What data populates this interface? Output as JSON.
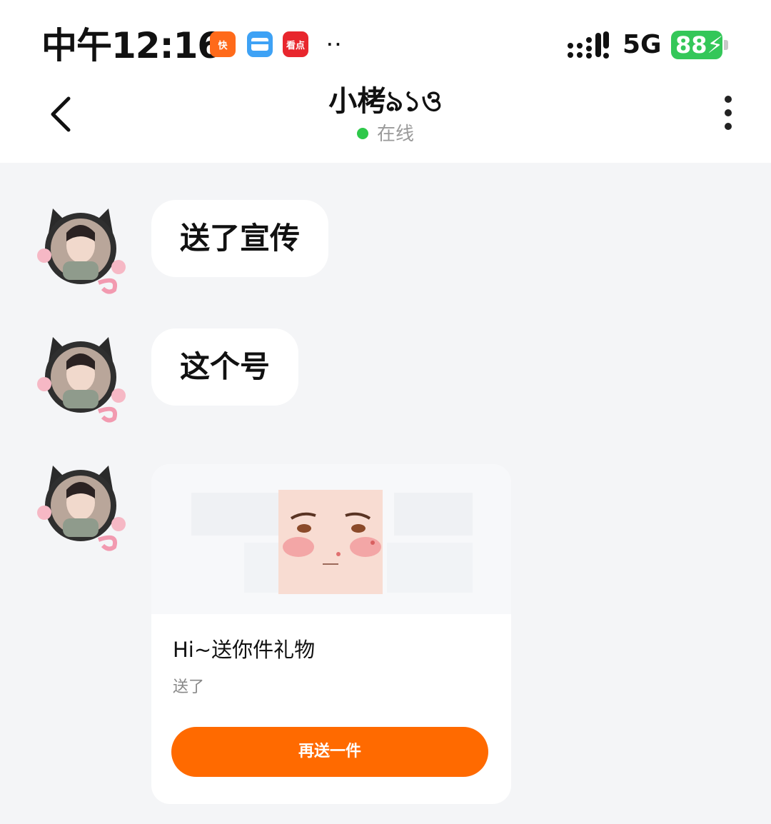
{
  "status_bar": {
    "time": "中午12:16",
    "network": "5G",
    "battery": "88",
    "extra": "··",
    "apps": [
      {
        "name": "kuaishou-app-icon",
        "glyph": "快"
      },
      {
        "name": "wallet-app-icon",
        "glyph": ""
      },
      {
        "name": "kandian-app-icon",
        "glyph": "看点"
      }
    ]
  },
  "header": {
    "contact_name": "小栲ঌ১ও",
    "presence": "在线"
  },
  "messages": [
    {
      "type": "text",
      "text": "送了宣传"
    },
    {
      "type": "text",
      "text": "这个号"
    },
    {
      "type": "gift",
      "title": "Hi~送你件礼物",
      "status": "送了",
      "action": "再送一件"
    }
  ],
  "colors": {
    "accent": "#ff6a00",
    "online": "#2ec84a",
    "battery": "#34c759",
    "background": "#f4f5f7"
  },
  "icons": {
    "back": "chevron-left-icon",
    "more": "more-vertical-icon",
    "signal": "signal-bars-icon",
    "battery": "battery-charging-icon"
  }
}
